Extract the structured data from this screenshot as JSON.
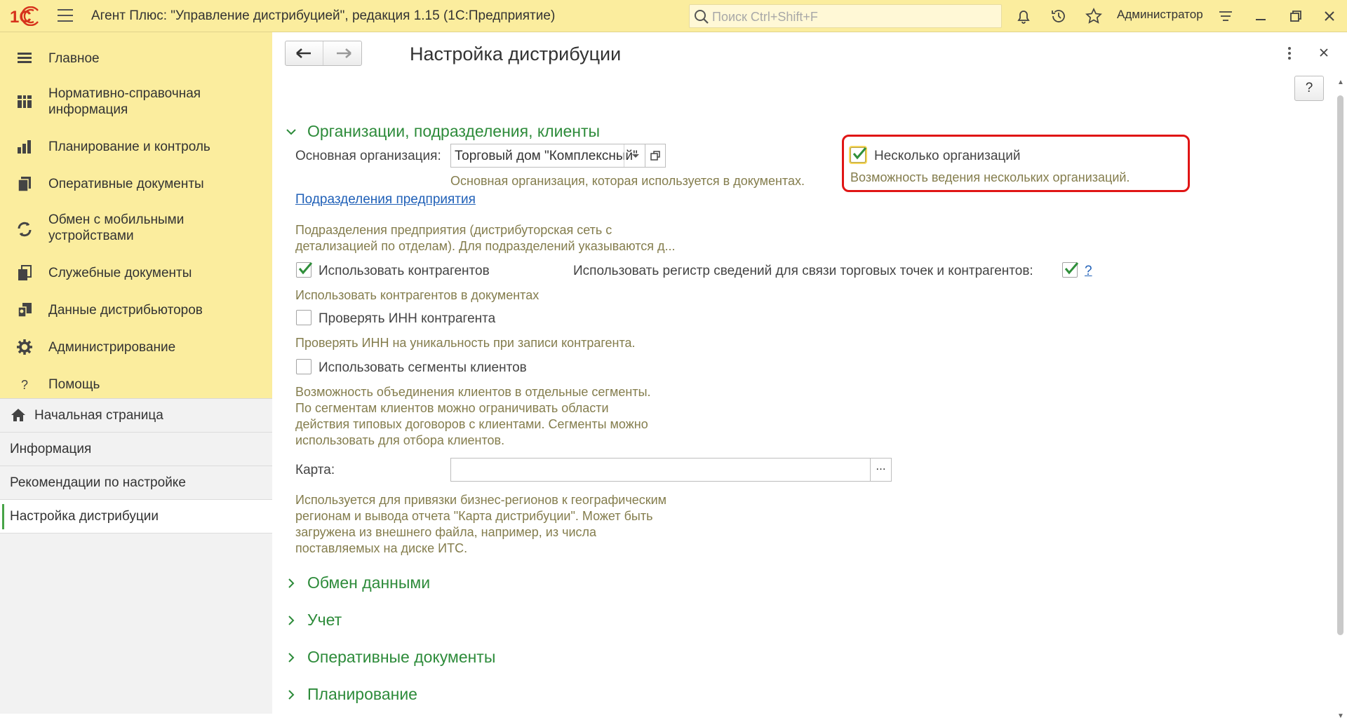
{
  "app": {
    "logo_text": "1С",
    "title": "Агент Плюс: \"Управление дистрибуцией\", редакция 1.15  (1С:Предприятие)",
    "search_placeholder": "Поиск Ctrl+Shift+F",
    "user": "Администратор",
    "icons": [
      "bell-icon",
      "history-icon",
      "star-icon",
      "settings-lines-icon",
      "minimize-icon",
      "restore-icon",
      "close-icon"
    ]
  },
  "sidebar": {
    "sections": [
      {
        "label": "Главное",
        "icon": "menu-lines-icon"
      },
      {
        "label": "Нормативно-справочная информация",
        "icon": "catalog-icon"
      },
      {
        "label": "Планирование и контроль",
        "icon": "bar-chart-icon"
      },
      {
        "label": "Оперативные документы",
        "icon": "documents-icon"
      },
      {
        "label": "Обмен с мобильными устройствами",
        "icon": "sync-icon"
      },
      {
        "label": "Служебные документы",
        "icon": "service-docs-icon"
      },
      {
        "label": "Данные дистрибьюторов",
        "icon": "distributor-data-icon"
      },
      {
        "label": "Администрирование",
        "icon": "gear-icon"
      },
      {
        "label": "Помощь",
        "icon": "question-icon"
      }
    ],
    "nav": [
      {
        "label": "Начальная страница",
        "icon": "home-icon"
      },
      {
        "label": "Информация"
      },
      {
        "label": "Рекомендации по настройке"
      },
      {
        "label": "Настройка дистрибуции",
        "active": true
      }
    ]
  },
  "form": {
    "title": "Настройка дистрибуции",
    "help_label": "?",
    "groups": {
      "orgs": {
        "title": "Организации, подразделения, клиенты",
        "main_org_label": "Основная организация:",
        "main_org_value": "Торговый дом \"Комплексный\"",
        "main_org_note": "Основная организация, которая используется в документах.",
        "multi_org_label": "Несколько организаций",
        "multi_org_checked": true,
        "multi_org_note": "Возможность ведения нескольких организаций.",
        "divisions_link": "Подразделения предприятия",
        "divisions_note_1": "Подразделения предприятия (дистрибуторская сеть с",
        "divisions_note_2": "детализацией по отделам). Для подразделений указываются д...",
        "use_contractors_label": "Использовать контрагентов",
        "use_contractors_checked": true,
        "use_contractors_note": "Использовать контрагентов в документах",
        "register_label": "Использовать регистр сведений для связи торговых точек и контрагентов:",
        "register_checked": true,
        "register_help": "?",
        "check_inn_label": "Проверять ИНН контрагента",
        "check_inn_checked": false,
        "check_inn_note": "Проверять ИНН на уникальность при записи контрагента.",
        "segments_label": "Использовать сегменты клиентов",
        "segments_checked": false,
        "segments_note_1": "Возможность объединения клиентов в отдельные сегменты.",
        "segments_note_2": "По сегментам клиентов можно ограничивать области",
        "segments_note_3": "действия типовых договоров с клиентами. Сегменты можно",
        "segments_note_4": "использовать для отбора клиентов.",
        "map_label": "Карта:",
        "map_value": "",
        "map_select": "...",
        "map_note_1": "Используется для привязки бизнес-регионов к географическим",
        "map_note_2": "регионам и вывода отчета \"Карта дистрибуции\". Может быть",
        "map_note_3": "загружена из внешнего файла, например, из числа",
        "map_note_4": "поставляемых на диске ИТС."
      },
      "collapsed": [
        "Обмен данными",
        "Учет",
        "Оперативные документы",
        "Планирование"
      ]
    }
  },
  "colors": {
    "topbar": "#fbed9e",
    "group_title": "#2d8b3a",
    "note": "#847d4d",
    "link": "#2161b8",
    "highlight_frame": "#e01515",
    "check": "#2f8f3a"
  }
}
